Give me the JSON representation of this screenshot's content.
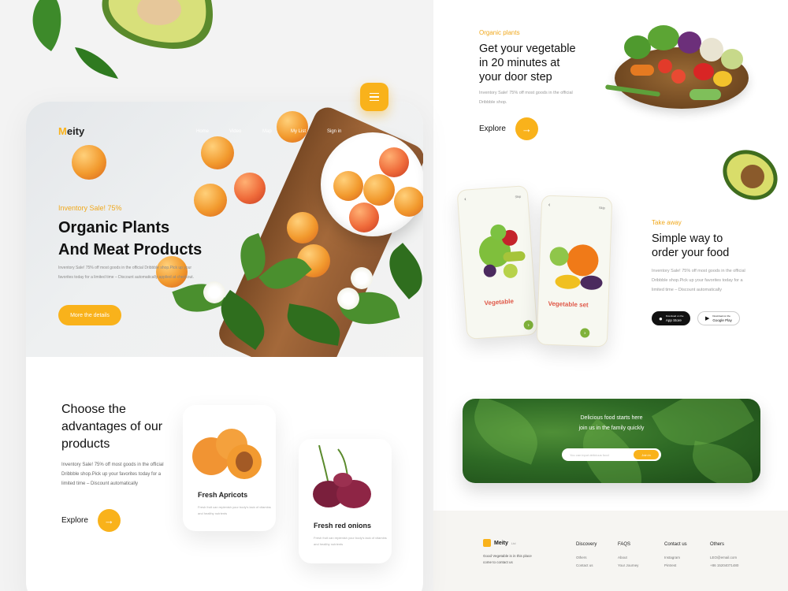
{
  "brand": {
    "logo_prefix": "M",
    "logo_rest": "eity",
    "accent": "#f9b21b"
  },
  "nav": [
    "Home",
    "Video",
    "Map",
    "My List",
    "Sign in"
  ],
  "hero": {
    "tag": "Inventory Sale! 75%",
    "title_line1": "Organic Plants",
    "title_line2": "And Meat Products",
    "description": "Inventory Sale! 75% off most goods in the official Dribbble shop.Pick up your favorites today for a limited time – Discount automatically applied at checkout.",
    "cta": "More the details"
  },
  "advantages": {
    "title": "Choose the advantages of our products",
    "description": "Inventory Sale! 75% off most goods in the official Dribbble shop.Pick up your favorites today for a limited time – Discount automatically",
    "explore_label": "Explore",
    "arrow": "→"
  },
  "products": [
    {
      "name": "Fresh Apricots",
      "description": "Fresh fruit can replenish your body's lack of vitamins and healthy nutrients"
    },
    {
      "name": "Fresh red onions",
      "description": "Fresh fruit can replenish your body's lack of vitamins and healthy nutrients"
    }
  ],
  "organic": {
    "tag": "Organic plants",
    "title_line1": "Get your vegetable",
    "title_line2": "in 20 minutes at",
    "title_line3": "your door step",
    "description": "Inventory Sale! 75% off most goods in the official Dribbble shop.",
    "explore_label": "Explore",
    "arrow": "→"
  },
  "takeaway": {
    "tag": "Take away",
    "title_line1": "Simple way to",
    "title_line2": "order your food",
    "description": "Inventory Sale! 75% off most goods in the official Dribbble shop.Pick up your favorites today for a limited time – Discount automatically",
    "app_store": "App Store",
    "app_store_small": "Download on the",
    "google_play": "Google Play",
    "google_play_small": "Download on the"
  },
  "phones": [
    {
      "label": "Vegetable",
      "skip": "Skip",
      "back": "‹",
      "go": "›"
    },
    {
      "label": "Vegetable set",
      "skip": "Skip",
      "back": "‹",
      "go": "›"
    }
  ],
  "newsletter": {
    "line1": "Delicious food starts here",
    "line2": "join us in the family quickly",
    "placeholder": "You can input delicious food",
    "button": "Join in"
  },
  "footer": {
    "logo": "Meity",
    "logo_sub": "Ltd",
    "description": "Good Vegetable is in this place come to contact us",
    "columns": [
      {
        "heading": "Discovery",
        "items": [
          "Others",
          "Contact us"
        ]
      },
      {
        "heading": "FAQS",
        "items": [
          "About",
          "Your Journey"
        ]
      },
      {
        "heading": "Contact us",
        "items": [
          "Instagram",
          "Pintrest"
        ]
      },
      {
        "heading": "Others",
        "items": [
          "LEO@email.com",
          "+86 15204071480"
        ]
      }
    ]
  },
  "icons": {
    "menu": "hamburger-icon",
    "arrow": "arrow-right-icon",
    "apple": "apple-icon",
    "play": "play-store-icon"
  }
}
